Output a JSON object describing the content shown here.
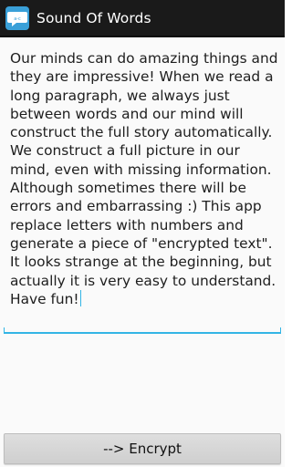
{
  "header": {
    "title": "Sound Of Words",
    "icon": "speech-bubble-icon"
  },
  "editor": {
    "text": "Our minds can do amazing things and they are impressive! When we read a long paragraph, we always just between words and our mind will construct the full story automatically. We construct a full picture in our mind, even with missing information. Although sometimes there will be errors and embarrassing :) This app replace letters with numbers and generate a piece of \"encrypted text\". It looks strange at the beginning, but actually it is very easy to understand. Have fun!",
    "accent_color": "#33b5e5"
  },
  "footer": {
    "encrypt_label": "--> Encrypt"
  }
}
